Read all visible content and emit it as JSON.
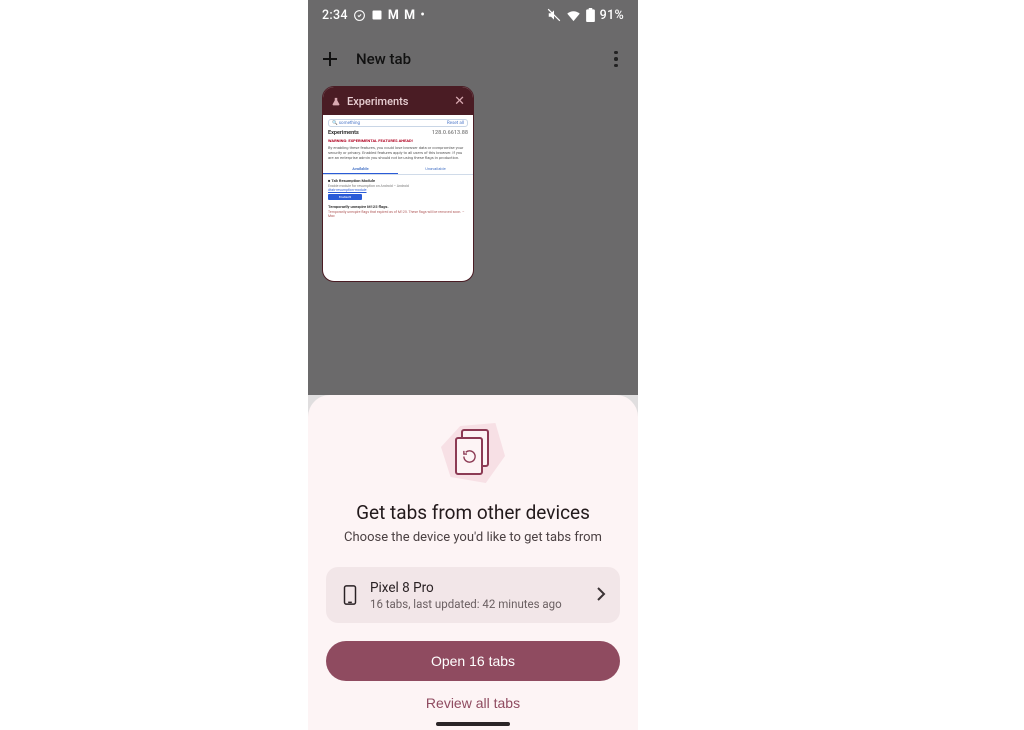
{
  "statusbar": {
    "time": "2:34",
    "battery_pct": "91%"
  },
  "toolbar": {
    "title": "New tab"
  },
  "tabcard": {
    "title": "Experiments",
    "search_text": "something",
    "reset_label": "Reset all",
    "heading": "Experiments",
    "version": "128.0.6613.88",
    "warning": "WARNING: EXPERIMENTAL FEATURES AHEAD!",
    "paragraph": "By enabling these features, you could lose browser data or compromise your security or privacy. Enabled features apply to all users of this browser. If you are an enterprise admin you should not be using these flags in production.",
    "tab_available": "Available",
    "tab_unavailable": "Unavailable",
    "flag1_title": "Tab Resumption Module",
    "flag1_desc": "Enable module for resumption on Android – Android",
    "flag1_link": "#tab-resumption-module",
    "flag1_btn": "Enabled",
    "flag2_title": "Temporarily unexpire M125 flags.",
    "flag2_desc": "Temporarily unexpire flags that expired as of M125. These flags will be removed soon. – Mac"
  },
  "sheet": {
    "title": "Get tabs from other devices",
    "subtitle": "Choose the device you'd like to get tabs from",
    "device": {
      "name": "Pixel 8 Pro",
      "meta": "16 tabs, last updated: 42 minutes ago"
    },
    "primary_label": "Open 16 tabs",
    "secondary_label": "Review all tabs"
  }
}
